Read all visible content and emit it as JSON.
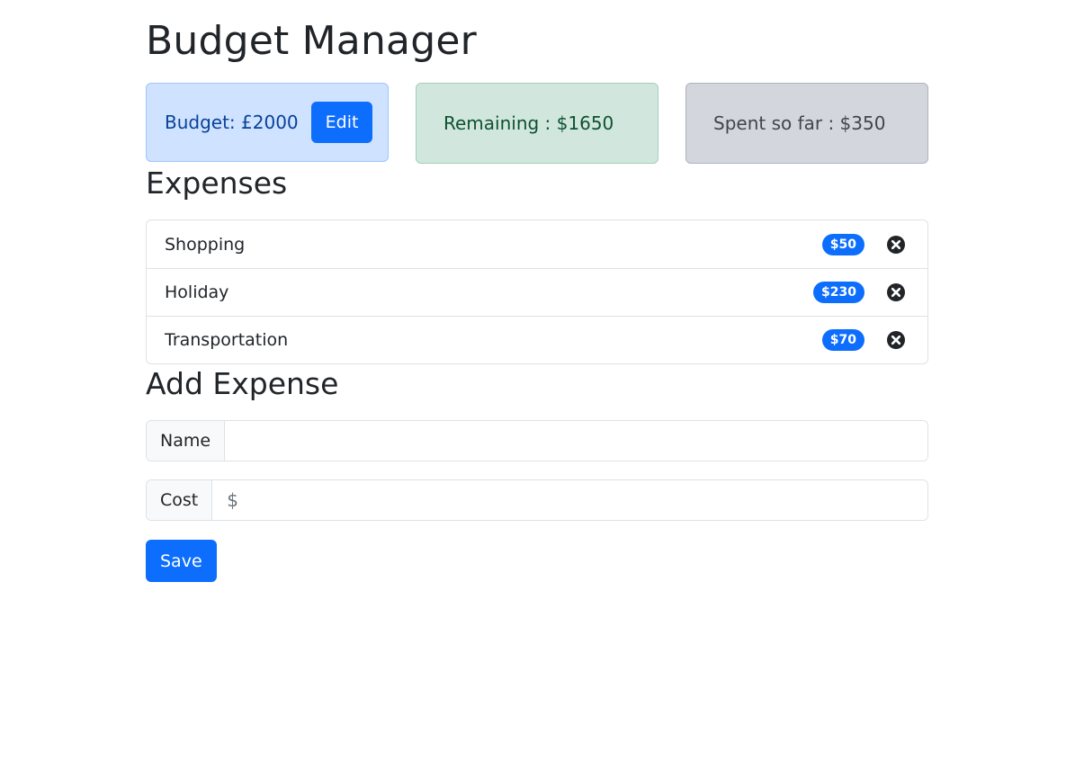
{
  "app": {
    "title": "Budget Manager"
  },
  "cards": {
    "budget_text": "Budget: £2000",
    "edit_label": "Edit",
    "remaining_text": "Remaining : $1650",
    "spent_text": "Spent so far : $350"
  },
  "expenses": {
    "heading": "Expenses",
    "items": [
      {
        "name": "Shopping",
        "cost": "$50"
      },
      {
        "name": "Holiday",
        "cost": "$230"
      },
      {
        "name": "Transportation",
        "cost": "$70"
      }
    ],
    "delete_icon": "x-circle-fill-icon"
  },
  "add_expense": {
    "heading": "Add Expense",
    "name_label": "Name",
    "name_value": "",
    "name_placeholder": "",
    "cost_label": "Cost",
    "cost_value": "",
    "cost_placeholder": "$",
    "save_label": "Save"
  },
  "colors": {
    "primary": "#0d6efd",
    "budget_bg": "#cfe2ff",
    "remaining_bg": "#d1e7dd",
    "spent_bg": "#d3d6dd"
  }
}
